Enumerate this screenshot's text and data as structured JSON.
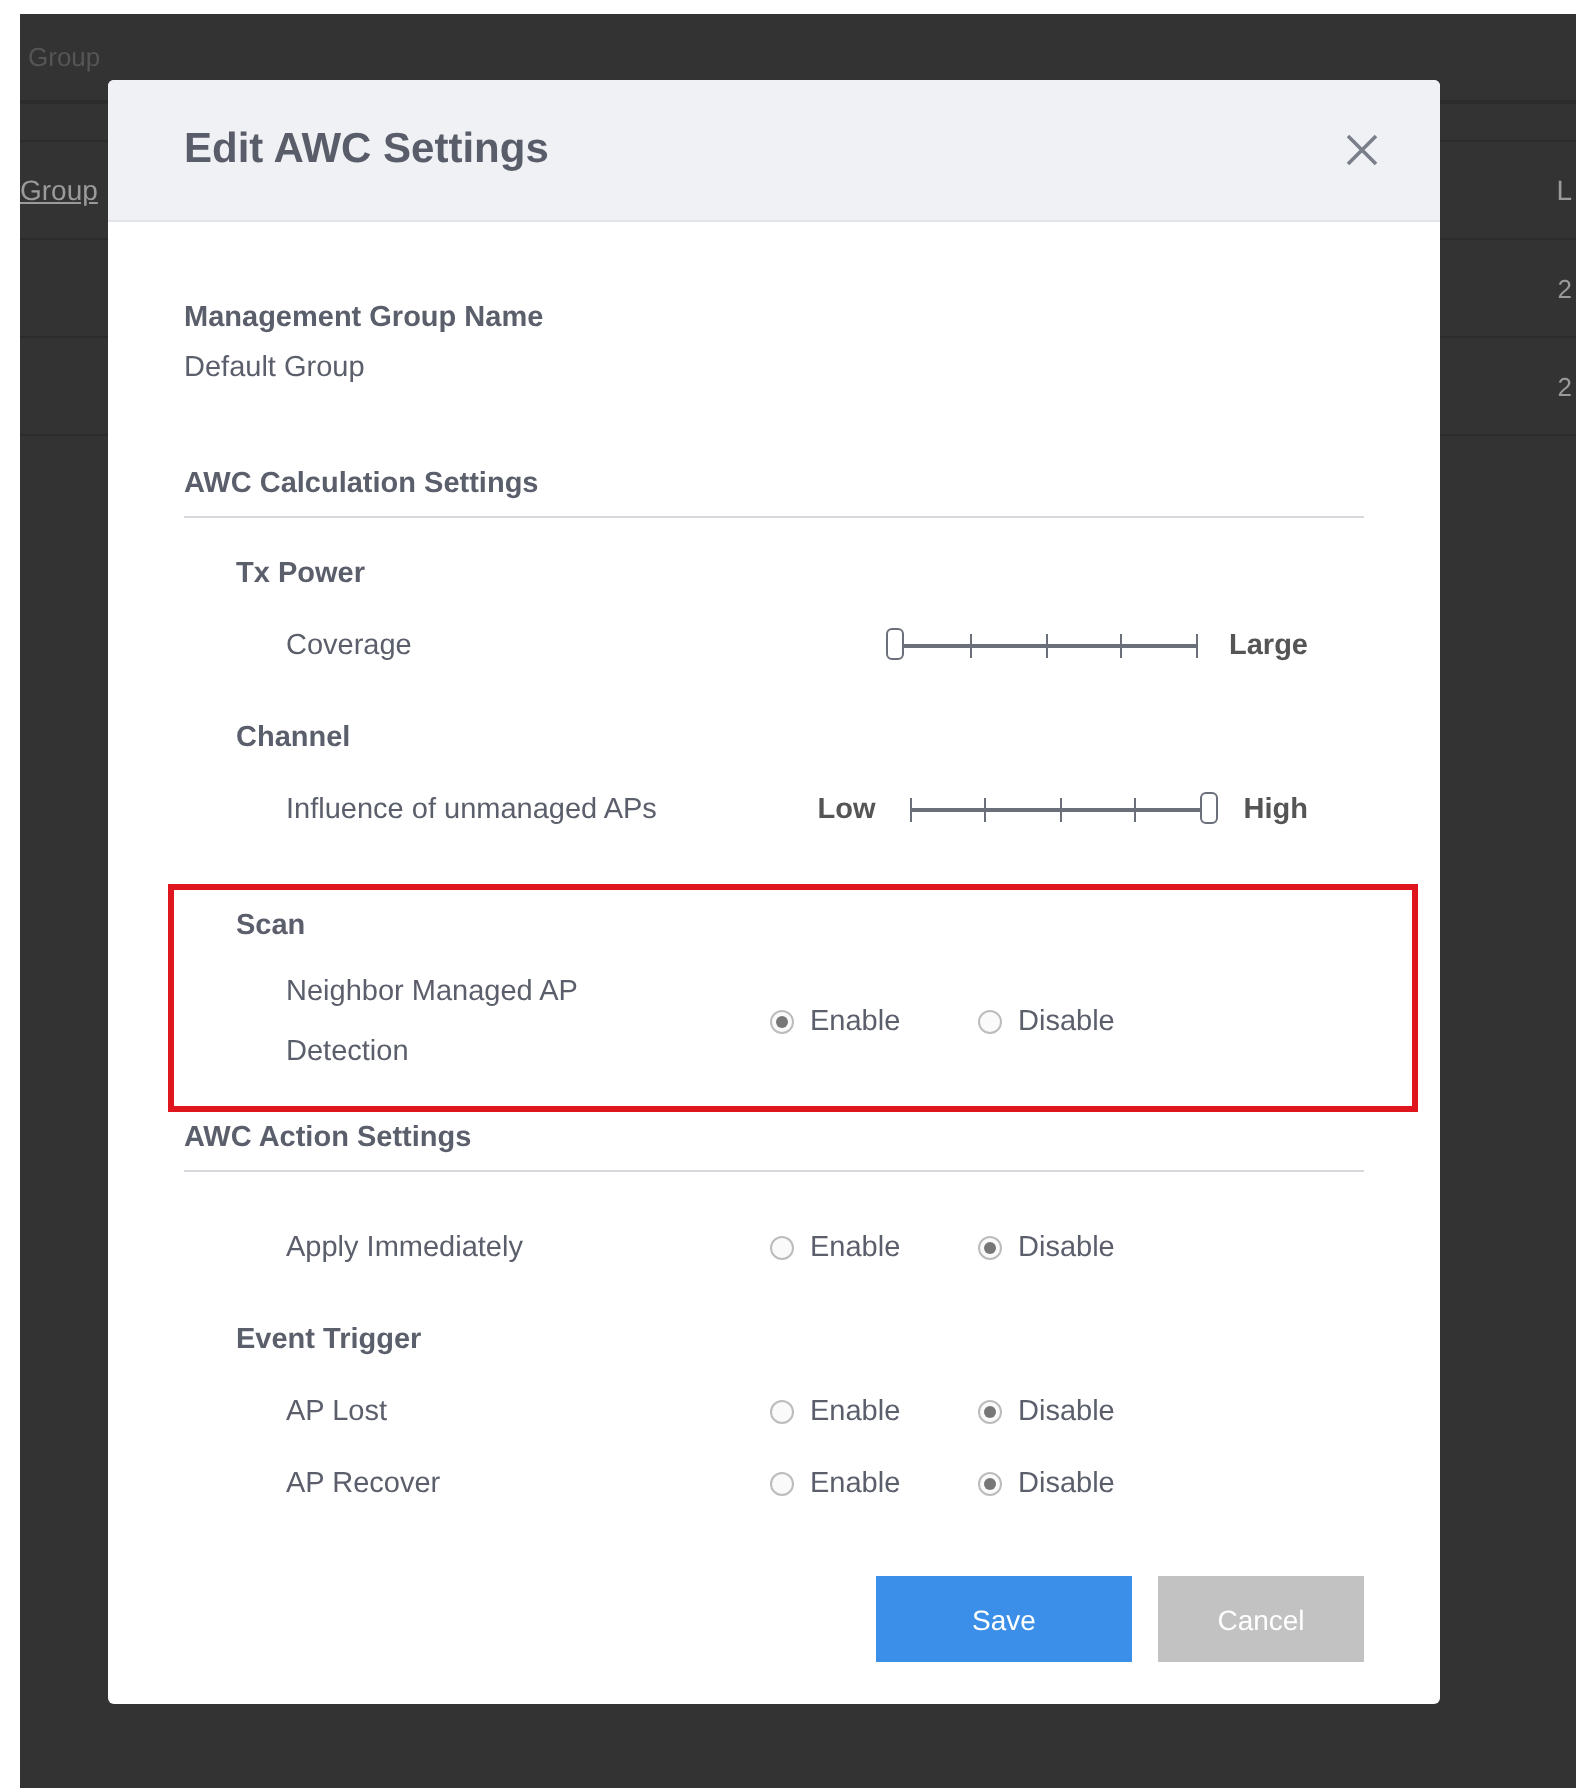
{
  "background": {
    "header_text": "Group",
    "column_header": "Group",
    "column_3": "L",
    "cells": [
      "2",
      "2"
    ]
  },
  "dialog": {
    "title": "Edit AWC Settings",
    "name_field": {
      "label": "Management Group Name",
      "value": "Default Group"
    },
    "sections": [
      {
        "title": "AWC Calculation Settings",
        "groups": [
          {
            "title": "Tx Power",
            "highlighted": false,
            "rows": [
              {
                "kind": "slider",
                "label": "Coverage",
                "max_label": "Large",
                "level": 0
              }
            ]
          },
          {
            "title": "Channel",
            "highlighted": false,
            "rows": [
              {
                "kind": "slider",
                "label": "Influence of unmanaged APs",
                "min_label": "Low",
                "max_label": "High",
                "level": 1
              }
            ]
          },
          {
            "title": "Scan",
            "highlighted": true,
            "rows": [
              {
                "kind": "radio",
                "label": "Neighbor Managed AP Detection",
                "options": [
                  {
                    "label": "Enable",
                    "selected": true
                  },
                  {
                    "label": "Disable",
                    "selected": false
                  }
                ]
              }
            ]
          }
        ]
      },
      {
        "title": "AWC Action Settings",
        "groups": [
          {
            "highlighted": false,
            "rows": [
              {
                "kind": "radio",
                "label": "Apply Immediately",
                "options": [
                  {
                    "label": "Enable",
                    "selected": false
                  },
                  {
                    "label": "Disable",
                    "selected": true
                  }
                ]
              }
            ]
          },
          {
            "title": "Event Trigger",
            "highlighted": false,
            "rows": [
              {
                "kind": "radio",
                "label": "AP Lost",
                "options": [
                  {
                    "label": "Enable",
                    "selected": false
                  },
                  {
                    "label": "Disable",
                    "selected": true
                  }
                ]
              },
              {
                "kind": "radio",
                "label": "AP Recover",
                "options": [
                  {
                    "label": "Enable",
                    "selected": false
                  },
                  {
                    "label": "Disable",
                    "selected": true
                  }
                ]
              }
            ]
          }
        ]
      }
    ],
    "buttons": [
      {
        "label": "Save",
        "kind": "primary"
      },
      {
        "label": "Cancel",
        "kind": "secondary"
      }
    ]
  }
}
